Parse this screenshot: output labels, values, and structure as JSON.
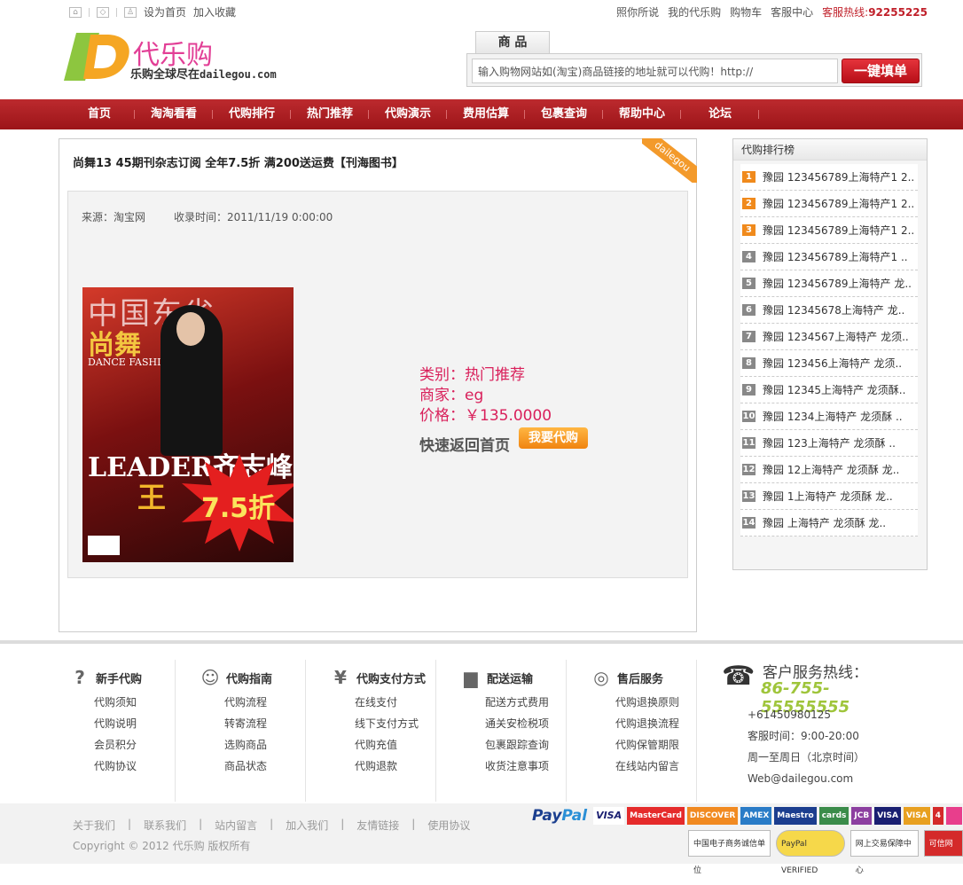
{
  "topbar": {
    "set_home": "设为首页",
    "add_favorite": "加入收藏",
    "links": [
      "照你所说",
      "我的代乐购",
      "购物车",
      "客服中心"
    ],
    "hotline_label": "客服热线:",
    "hotline_number": "92255225"
  },
  "logo": {
    "name": "代乐购",
    "tagline_cn": "乐购全球尽在",
    "tagline_domain": "dailegou.com"
  },
  "search": {
    "tab": "商 品",
    "placeholder": "输入购物网站如(淘宝)商品链接的地址就可以代购！http://",
    "button": "一键填单"
  },
  "nav": {
    "items": [
      "首页",
      "淘淘看看",
      "代购排行",
      "热门推荐",
      "代购演示",
      "费用估算",
      "包裹查询",
      "帮助中心",
      "论坛"
    ]
  },
  "product": {
    "title": "尚舞13 45期刊杂志订阅 全年7.5折 满200送运费【刊海图书】",
    "ribbon": "dailegou",
    "source": "来源：淘宝网",
    "collected": "收录时间：2011/11/19 0:00:00",
    "category": "类别：热门推荐",
    "merchant": "商家：eg",
    "price": "价格：￥135.0000",
    "back_home": "快速返回首页",
    "buy_button": "我要代购",
    "cover": {
      "t1": "中国东省",
      "t2": "尚舞",
      "t3": "DANCE FASHION",
      "t4": "LEADER齐志峰",
      "t5": "王",
      "discount": "7.5折"
    }
  },
  "ranking": {
    "title": "代购排行榜",
    "items": [
      {
        "n": "1",
        "text": "豫园 123456789上海特产1 2.."
      },
      {
        "n": "2",
        "text": "豫园 123456789上海特产1 2.."
      },
      {
        "n": "3",
        "text": "豫园 123456789上海特产1 2.."
      },
      {
        "n": "4",
        "text": "豫园 123456789上海特产1 .."
      },
      {
        "n": "5",
        "text": "豫园 123456789上海特产 龙.."
      },
      {
        "n": "6",
        "text": "豫园 12345678上海特产 龙.."
      },
      {
        "n": "7",
        "text": "豫园 1234567上海特产 龙须.."
      },
      {
        "n": "8",
        "text": "豫园 123456上海特产 龙须.."
      },
      {
        "n": "9",
        "text": "豫园 12345上海特产 龙须酥.."
      },
      {
        "n": "10",
        "text": "豫园 1234上海特产 龙须酥 .."
      },
      {
        "n": "11",
        "text": "豫园 123上海特产 龙须酥 .."
      },
      {
        "n": "12",
        "text": "豫园 12上海特产 龙须酥 龙.."
      },
      {
        "n": "13",
        "text": "豫园 1上海特产 龙须酥 龙.."
      },
      {
        "n": "14",
        "text": "豫园 上海特产 龙须酥 龙.."
      }
    ]
  },
  "footer": {
    "columns": [
      {
        "title": "新手代购",
        "icon": "?",
        "links": [
          "代购须知",
          "代购说明",
          "会员积分",
          "代购协议"
        ]
      },
      {
        "title": "代购指南",
        "icon": "☺",
        "links": [
          "代购流程",
          "转寄流程",
          "选购商品",
          "商品状态"
        ]
      },
      {
        "title": "代购支付方式",
        "icon": "¥",
        "links": [
          "在线支付",
          "线下支付方式",
          "代购充值",
          "代购退款"
        ]
      },
      {
        "title": "配送运输",
        "icon": "▆",
        "links": [
          "配送方式费用",
          "通关安检税项",
          "包裹跟踪查询",
          "收货注意事项"
        ]
      },
      {
        "title": "售后服务",
        "icon": "◎",
        "links": [
          "代购退换原则",
          "代购退换流程",
          "代购保管期限",
          "在线站内留言"
        ]
      }
    ],
    "service": {
      "label": "客户服务热线：",
      "number": "86-755-55555555",
      "phone2": "+61450980125",
      "hours": "客服时间：9:00-20:00",
      "days": "周一至周日（北京时间）",
      "email": "Web@dailegou.com"
    },
    "bottom_links": [
      "关于我们",
      "联系我们",
      "站内留言",
      "加入我们",
      "友情链接",
      "使用协议"
    ],
    "copyright": "Copyright © 2012 代乐购 版权所有",
    "payments": {
      "paypal_a": "Pay",
      "paypal_b": "Pal",
      "cards": [
        "VISA",
        "MasterCard",
        "DISCOVER",
        "AMEX",
        "Maestro",
        "cards",
        "JCB",
        "VISA",
        "VISA",
        "4"
      ]
    },
    "seals": [
      "中国电子商务诚信单位",
      "PayPal VERIFIED",
      "网上交易保障中心",
      "可信网站"
    ]
  }
}
